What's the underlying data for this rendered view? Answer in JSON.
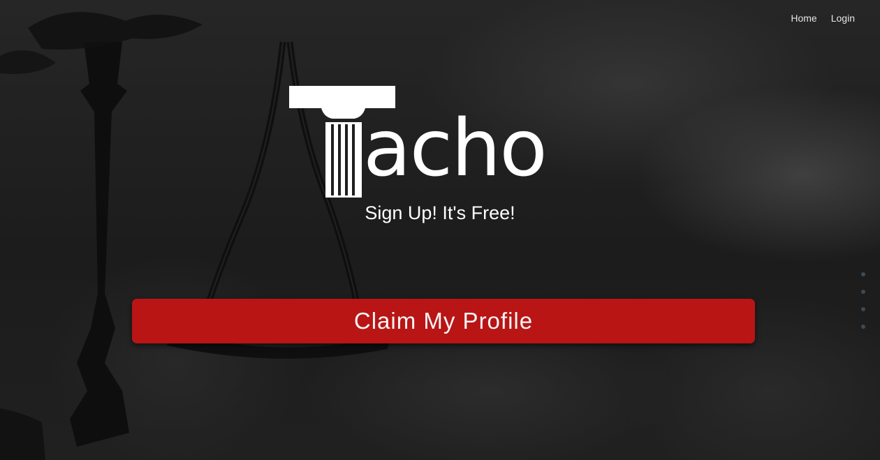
{
  "nav": {
    "items": [
      {
        "label": "Home"
      },
      {
        "label": "Login"
      }
    ]
  },
  "logo": {
    "text": "acho",
    "icon": "column-icon",
    "color": "#ffffff"
  },
  "hero": {
    "tagline": "Sign Up! It's Free!",
    "cta_label": "Claim My Profile",
    "cta_color": "#b91515"
  },
  "slider": {
    "dot_count": 4,
    "dot_color": "#3c4a55"
  }
}
